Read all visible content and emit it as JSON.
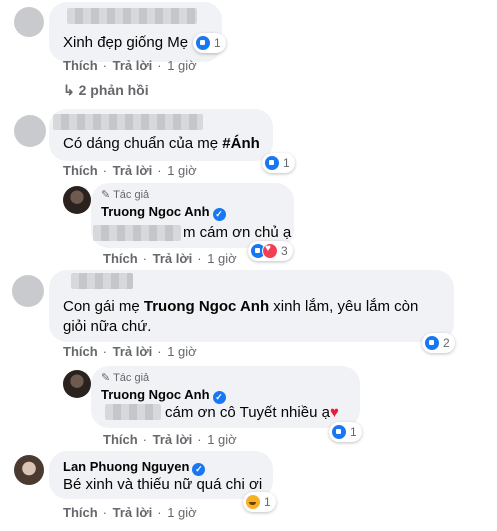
{
  "comments": [
    {
      "text": "Xinh đẹp giống Mẹ",
      "reactions": "1",
      "like_label": "Thích",
      "reply_label": "Trả lời",
      "time": "1 giờ",
      "replies_toggle": "2 phản hồi"
    },
    {
      "text_prefix": "Có dáng chuẩn của mẹ ",
      "text_tag": "#Ánh",
      "reactions": "1",
      "like_label": "Thích",
      "reply_label": "Trả lời",
      "time": "1 giờ",
      "reply": {
        "author_badge": "Tác giả",
        "author_name": "Truong Ngoc Anh",
        "text_suffix": "m cám ơn chủ ạ",
        "reactions": "3",
        "like_label": "Thích",
        "reply_label": "Trả lời",
        "time": "1 giờ"
      }
    },
    {
      "text_prefix": "Con gái mẹ ",
      "text_mention": "Truong Ngoc Anh",
      "text_suffix": " xinh lắm, yêu lắm còn",
      "text_line2": "giỏi nữa chứ.",
      "reactions": "2",
      "like_label": "Thích",
      "reply_label": "Trả lời",
      "time": "1 giờ",
      "reply": {
        "author_badge": "Tác giả",
        "author_name": "Truong Ngoc Anh",
        "text": "cám ơn cô Tuyết nhiều ạ",
        "reactions": "1",
        "like_label": "Thích",
        "reply_label": "Trả lời",
        "time": "1 giờ"
      }
    },
    {
      "author_name": "Lan Phuong Nguyen",
      "text": "Bé xinh và thiếu nữ quá chi ơi",
      "reactions": "1",
      "like_label": "Thích",
      "reply_label": "Trả lời",
      "time": "1 giờ"
    }
  ],
  "colors": {
    "accent": "#1877f2",
    "bubble": "#f0f2f5",
    "meta": "#65676b",
    "love": "#f33e58"
  }
}
